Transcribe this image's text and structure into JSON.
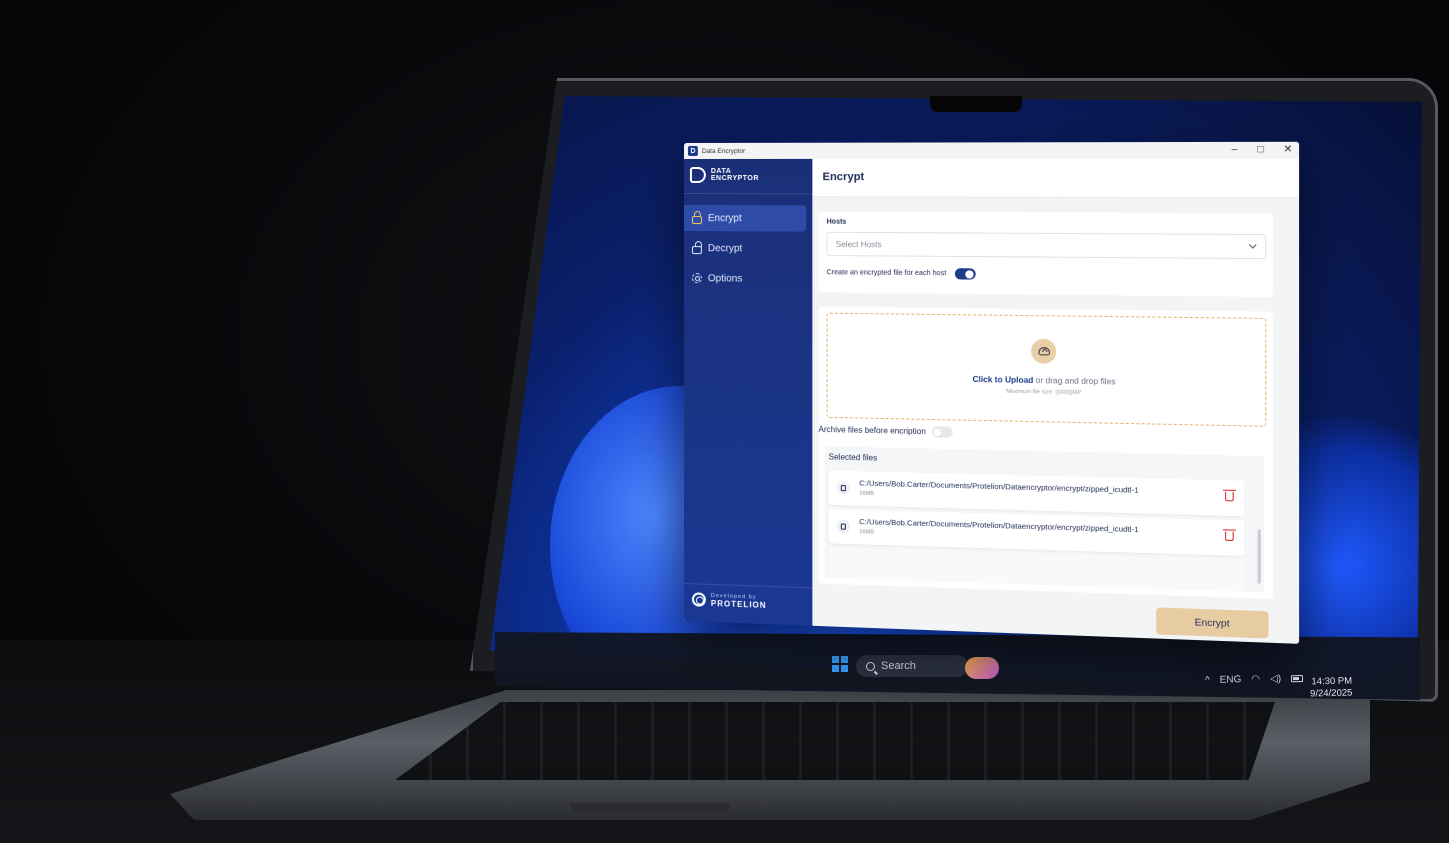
{
  "window": {
    "title": "Data Encryptor",
    "controls": {
      "minimize": "–",
      "maximize": "□",
      "close": "✕"
    }
  },
  "sidebar": {
    "brand_line1": "DATA",
    "brand_line2": "ENCRYPTOR",
    "items": [
      {
        "label": "Encrypt",
        "icon": "lock-icon",
        "active": true
      },
      {
        "label": "Decrypt",
        "icon": "unlock-icon",
        "active": false
      },
      {
        "label": "Options",
        "icon": "gear-icon",
        "active": false
      }
    ],
    "footer_line1": "Developed by",
    "footer_line2": "PROTELION"
  },
  "main": {
    "title": "Encrypt",
    "hosts": {
      "label": "Hosts",
      "placeholder": "Select Hosts",
      "each_host_label": "Create an encrypted file for each host",
      "each_host_enabled": true
    },
    "upload": {
      "cta": "Click to Upload",
      "rest": "or drag and drop files",
      "max": "Maximum file size: {{000}}MP"
    },
    "archive": {
      "label": "Archive files before encription",
      "enabled": false
    },
    "selected": {
      "title": "Selected files",
      "files": [
        {
          "path": "C:/Users/Bob.Carter/Documents/Protelion/Dataencryptor/encrypt/zipped_icudtl-1",
          "size": "16MB"
        },
        {
          "path": "C:/Users/Bob.Carter/Documents/Protelion/Dataencryptor/encrypt/zipped_icudtl-1",
          "size": "16MB"
        }
      ]
    },
    "encrypt_button": "Encrypt"
  },
  "taskbar": {
    "search": "Search",
    "caret": "^",
    "lang": "ENG",
    "time": "14:30 PM",
    "date": "9/24/2025"
  },
  "colors": {
    "sidebar": "#1b2f78",
    "accent": "#1e3a8a",
    "upload_border": "#e2b46e",
    "encrypt_button": "#e7cba1",
    "delete": "#dc2626"
  }
}
